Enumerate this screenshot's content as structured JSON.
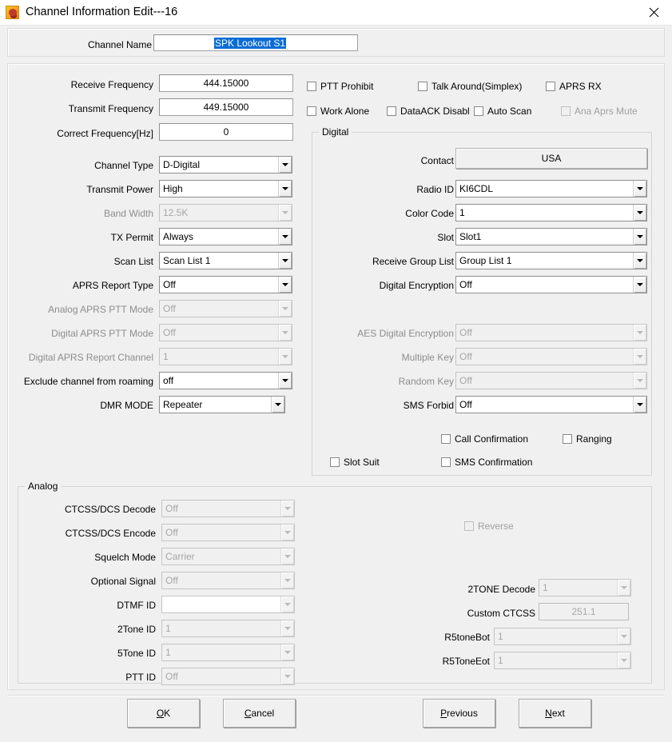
{
  "window": {
    "title": "Channel Information Edit---16",
    "icon": "app-icon",
    "close_label": "✕"
  },
  "channel_name": {
    "label": "Channel Name",
    "value": "SPK Lookout S1",
    "selected": true
  },
  "general": {
    "receive_frequency": {
      "label": "Receive Frequency",
      "value": "444.15000"
    },
    "transmit_frequency": {
      "label": "Transmit Frequency",
      "value": "449.15000"
    },
    "correct_frequency": {
      "label": "Correct Frequency[Hz]",
      "value": "0"
    }
  },
  "top_checkboxes": [
    {
      "label": "PTT Prohibit",
      "checked": false,
      "disabled": false
    },
    {
      "label": "Talk Around(Simplex)",
      "checked": false,
      "disabled": false
    },
    {
      "label": "APRS RX",
      "checked": false,
      "disabled": false
    },
    {
      "label": "Work Alone",
      "checked": false,
      "disabled": false
    },
    {
      "label": "DataACK Disabl",
      "checked": false,
      "disabled": false
    },
    {
      "label": "Auto Scan",
      "checked": false,
      "disabled": false
    },
    {
      "label": "Ana Aprs Mute",
      "checked": false,
      "disabled": true
    }
  ],
  "left_fields": [
    {
      "label": "Channel Type",
      "value": "D-Digital",
      "disabled": false
    },
    {
      "label": "Transmit Power",
      "value": "High",
      "disabled": false
    },
    {
      "label": "Band Width",
      "value": "12.5K",
      "disabled": true
    },
    {
      "label": "TX Permit",
      "value": "Always",
      "disabled": false
    },
    {
      "label": "Scan List",
      "value": "Scan List 1",
      "disabled": false
    },
    {
      "label": "APRS Report Type",
      "value": "Off",
      "disabled": false
    },
    {
      "label": "Analog APRS PTT Mode",
      "value": "Off",
      "disabled": true
    },
    {
      "label": "Digital APRS PTT Mode",
      "value": "Off",
      "disabled": true
    },
    {
      "label": "Digital APRS Report Channel",
      "value": "1",
      "disabled": true
    },
    {
      "label": "Exclude channel from roaming",
      "value": "off",
      "disabled": false
    },
    {
      "label": "DMR MODE",
      "value": "Repeater",
      "disabled": false
    }
  ],
  "digital": {
    "legend": "Digital",
    "contact": {
      "label": "Contact",
      "value": "USA"
    },
    "fields": [
      {
        "label": "Radio ID",
        "value": "KI6CDL",
        "disabled": false
      },
      {
        "label": "Color Code",
        "value": "1",
        "disabled": false
      },
      {
        "label": "Slot",
        "value": "Slot1",
        "disabled": false
      },
      {
        "label": "Receive Group List",
        "value": "Group List 1",
        "disabled": false
      },
      {
        "label": "Digital Encryption",
        "value": "Off",
        "disabled": false
      },
      {
        "label": "AES Digital Encryption",
        "value": "Off",
        "disabled": true
      },
      {
        "label": "Multiple Key",
        "value": "Off",
        "disabled": true
      },
      {
        "label": "Random Key",
        "value": "Off",
        "disabled": true
      },
      {
        "label": "SMS Forbid",
        "value": "Off",
        "disabled": false
      }
    ],
    "checkboxes": [
      {
        "label": "Call Confirmation",
        "checked": false,
        "disabled": false
      },
      {
        "label": "Ranging",
        "checked": false,
        "disabled": false
      },
      {
        "label": "Slot Suit",
        "checked": false,
        "disabled": false
      },
      {
        "label": "SMS Confirmation",
        "checked": false,
        "disabled": false
      }
    ]
  },
  "analog": {
    "legend": "Analog",
    "fields": [
      {
        "label": "CTCSS/DCS Decode",
        "value": "Off",
        "disabled": true
      },
      {
        "label": "CTCSS/DCS Encode",
        "value": "Off",
        "disabled": true
      },
      {
        "label": "Squelch Mode",
        "value": "Carrier",
        "disabled": true
      },
      {
        "label": "Optional Signal",
        "value": "Off",
        "disabled": true
      },
      {
        "label": "DTMF ID",
        "value": "",
        "disabled": true
      },
      {
        "label": "2Tone ID",
        "value": "1",
        "disabled": true
      },
      {
        "label": "5Tone ID",
        "value": "1",
        "disabled": true
      },
      {
        "label": "PTT ID",
        "value": "Off",
        "disabled": true
      }
    ],
    "reverse": {
      "label": "Reverse",
      "checked": false,
      "disabled": true
    },
    "right_fields": [
      {
        "label": "2TONE Decode",
        "value": "1",
        "disabled": true,
        "type": "combo"
      },
      {
        "label": "Custom CTCSS",
        "value": "251.1",
        "disabled": true,
        "type": "text"
      },
      {
        "label": "R5toneBot",
        "value": "1",
        "disabled": true,
        "type": "combo"
      },
      {
        "label": "R5ToneEot",
        "value": "1",
        "disabled": true,
        "type": "combo"
      }
    ]
  },
  "buttons": {
    "ok": {
      "accel": "O",
      "rest": "K"
    },
    "cancel": {
      "accel": "C",
      "rest": "ancel"
    },
    "previous": {
      "accel": "P",
      "rest": "revious"
    },
    "next": {
      "accel": "N",
      "rest": "ext"
    }
  }
}
